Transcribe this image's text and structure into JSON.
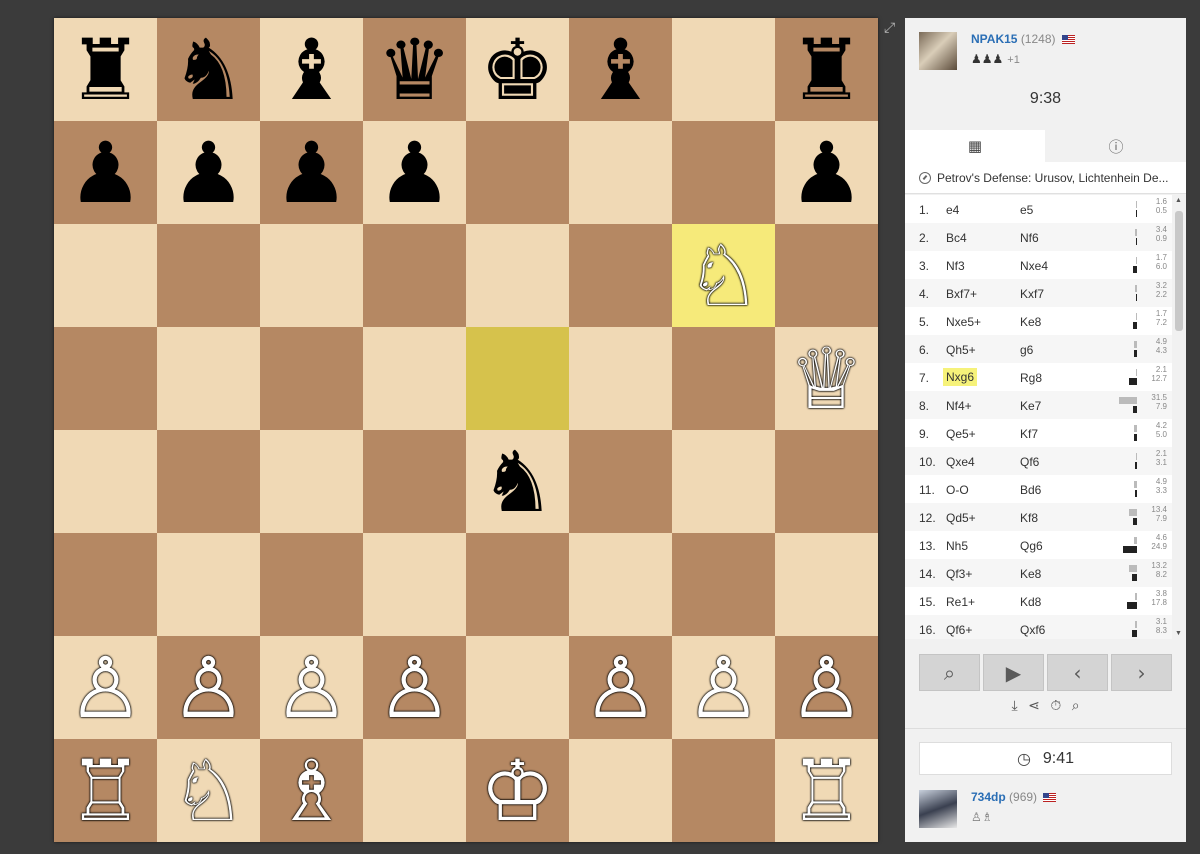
{
  "board": {
    "rows": [
      [
        "♜",
        "♞",
        "♝",
        "♛",
        "♚",
        "♝",
        "",
        "♜"
      ],
      [
        "♟",
        "♟",
        "♟",
        "♟",
        "",
        "",
        "",
        "♟"
      ],
      [
        "",
        "",
        "",
        "",
        "",
        "",
        "♘",
        ""
      ],
      [
        "",
        "",
        "",
        "",
        "",
        "",
        "",
        "♕"
      ],
      [
        "",
        "",
        "",
        "",
        "♞",
        "",
        "",
        ""
      ],
      [
        "",
        "",
        "",
        "",
        "",
        "",
        "",
        ""
      ],
      [
        "♙",
        "♙",
        "♙",
        "♙",
        "",
        "♙",
        "♙",
        "♙"
      ],
      [
        "♖",
        "♘",
        "♗",
        "",
        "♔",
        "",
        "",
        "♖"
      ]
    ],
    "colors": [
      [
        "b",
        "b",
        "b",
        "b",
        "b",
        "b",
        "",
        "b"
      ],
      [
        "b",
        "b",
        "b",
        "b",
        "",
        "",
        "",
        "b"
      ],
      [
        "",
        "",
        "",
        "",
        "",
        "",
        "w",
        ""
      ],
      [
        "",
        "",
        "",
        "",
        "",
        "",
        "",
        "w"
      ],
      [
        "",
        "",
        "",
        "",
        "b",
        "",
        "",
        ""
      ],
      [
        "",
        "",
        "",
        "",
        "",
        "",
        "",
        ""
      ],
      [
        "w",
        "w",
        "w",
        "w",
        "",
        "w",
        "w",
        "w"
      ],
      [
        "w",
        "w",
        "w",
        "",
        "w",
        "",
        "",
        "w"
      ]
    ],
    "highlight_from": "e5",
    "highlight_to": "g6"
  },
  "expand_icon": "⤢",
  "top_player": {
    "name": "NPAK15",
    "rating": "(1248)",
    "captured": "♟♟♟",
    "material": "+1",
    "clock": "9:38"
  },
  "bottom_player": {
    "name": "734dp",
    "rating": "(969)",
    "captured": "♙♗",
    "clock": "9:41"
  },
  "tabs": {
    "moves_icon": "▦",
    "info_icon": "ⓘ"
  },
  "opening": "Petrov's Defense: Urusov, Lichtenhein De...",
  "moves": [
    {
      "n": "1.",
      "w": "e4",
      "b": "e5",
      "t1": "1.6",
      "t2": "0.5",
      "tw": 1,
      "tb": 0
    },
    {
      "n": "2.",
      "w": "Bc4",
      "b": "Nf6",
      "t1": "3.4",
      "t2": "0.9",
      "tw": 2,
      "tb": 1
    },
    {
      "n": "3.",
      "w": "Nf3",
      "b": "Nxe4",
      "t1": "1.7",
      "t2": "6.0",
      "tw": 1,
      "tb": 4
    },
    {
      "n": "4.",
      "w": "Bxf7+",
      "b": "Kxf7",
      "t1": "3.2",
      "t2": "2.2",
      "tw": 2,
      "tb": 1
    },
    {
      "n": "5.",
      "w": "Nxe5+",
      "b": "Ke8",
      "t1": "1.7",
      "t2": "7.2",
      "tw": 1,
      "tb": 4
    },
    {
      "n": "6.",
      "w": "Qh5+",
      "b": "g6",
      "t1": "4.9",
      "t2": "4.3",
      "tw": 3,
      "tb": 3
    },
    {
      "n": "7.",
      "w": "Nxg6",
      "b": "Rg8",
      "t1": "2.1",
      "t2": "12.7",
      "tw": 1,
      "tb": 8,
      "hi": true
    },
    {
      "n": "8.",
      "w": "Nf4+",
      "b": "Ke7",
      "t1": "31.5",
      "t2": "7.9",
      "tw": 18,
      "tb": 4
    },
    {
      "n": "9.",
      "w": "Qe5+",
      "b": "Kf7",
      "t1": "4.2",
      "t2": "5.0",
      "tw": 3,
      "tb": 3
    },
    {
      "n": "10.",
      "w": "Qxe4",
      "b": "Qf6",
      "t1": "2.1",
      "t2": "3.1",
      "tw": 1,
      "tb": 2
    },
    {
      "n": "11.",
      "w": "O-O",
      "b": "Bd6",
      "t1": "4.9",
      "t2": "3.3",
      "tw": 3,
      "tb": 2
    },
    {
      "n": "12.",
      "w": "Qd5+",
      "b": "Kf8",
      "t1": "13.4",
      "t2": "7.9",
      "tw": 8,
      "tb": 4
    },
    {
      "n": "13.",
      "w": "Nh5",
      "b": "Qg6",
      "t1": "4.6",
      "t2": "24.9",
      "tw": 3,
      "tb": 14
    },
    {
      "n": "14.",
      "w": "Qf3+",
      "b": "Ke8",
      "t1": "13.2",
      "t2": "8.2",
      "tw": 8,
      "tb": 5
    },
    {
      "n": "15.",
      "w": "Re1+",
      "b": "Kd8",
      "t1": "3.8",
      "t2": "17.8",
      "tw": 2,
      "tb": 10
    },
    {
      "n": "16.",
      "w": "Qf6+",
      "b": "Qxf6",
      "t1": "3.1",
      "t2": "8.3",
      "tw": 2,
      "tb": 5
    }
  ],
  "controls": {
    "analysis_icon": "⌕",
    "play_icon": "▶",
    "prev_icon": "‹",
    "next_icon": "›"
  },
  "tools": {
    "download_icon": "⤓",
    "share_icon": "⋖",
    "timer_icon": "⏱",
    "explore_icon": "⌕"
  },
  "clock_icon": "◷"
}
